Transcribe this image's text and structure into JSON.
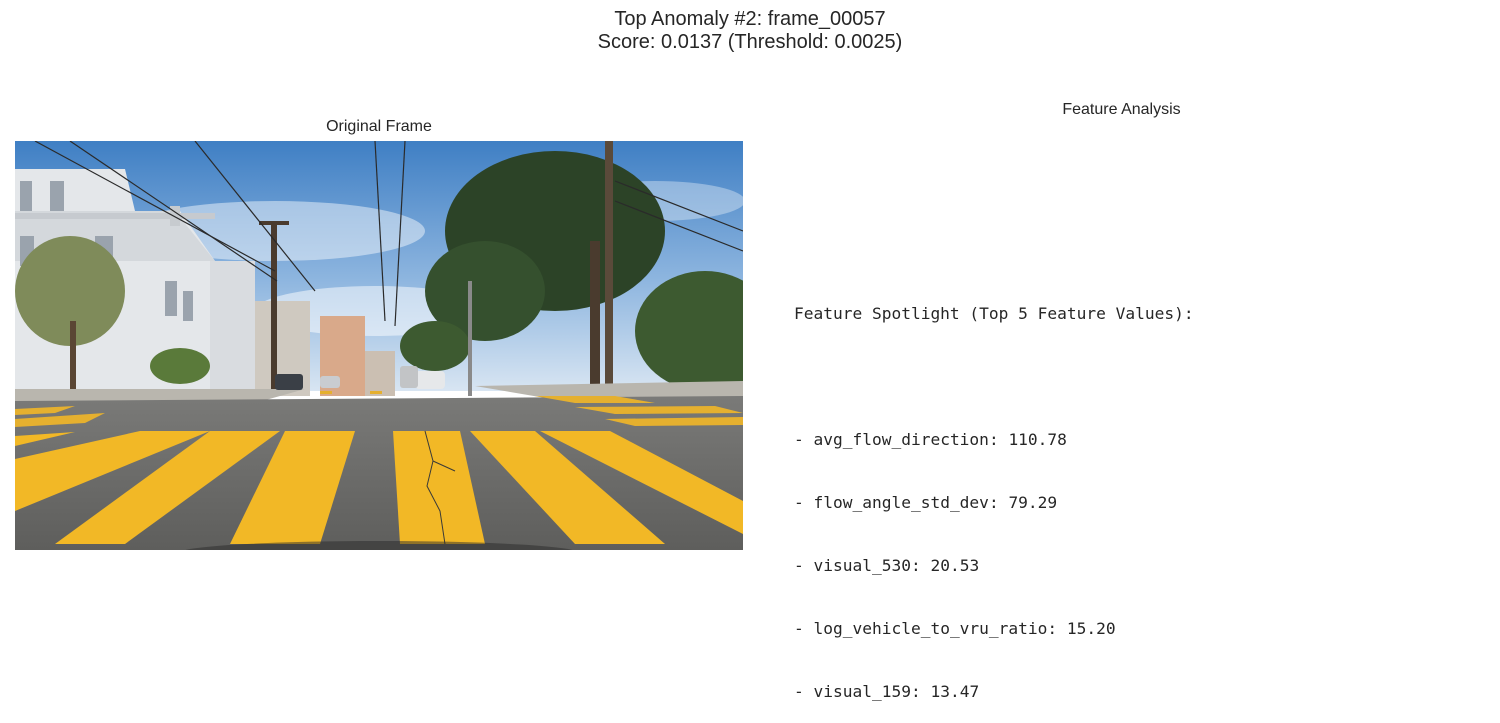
{
  "figure": {
    "title_line1": "Top Anomaly #2: frame_00057",
    "title_line2": "Score: 0.0137 (Threshold: 0.0025)"
  },
  "left_panel": {
    "title": "Original Frame"
  },
  "right_panel": {
    "title": "Feature Analysis",
    "heading": "Feature Spotlight (Top 5 Feature Values):",
    "features": [
      {
        "name": "avg_flow_direction",
        "value": "110.78"
      },
      {
        "name": "flow_angle_std_dev",
        "value": "79.29"
      },
      {
        "name": "visual_530",
        "value": "20.53"
      },
      {
        "name": "log_vehicle_to_vru_ratio",
        "value": "15.20"
      },
      {
        "name": "visual_159",
        "value": "13.47"
      }
    ]
  },
  "colors": {
    "sky_top": "#4a86c8",
    "sky_bottom": "#c9dcef",
    "road": "#6b6b6b",
    "crosswalk": "#f2b826",
    "building": "#e3e6ea",
    "foliage": "#2f4a2a"
  }
}
